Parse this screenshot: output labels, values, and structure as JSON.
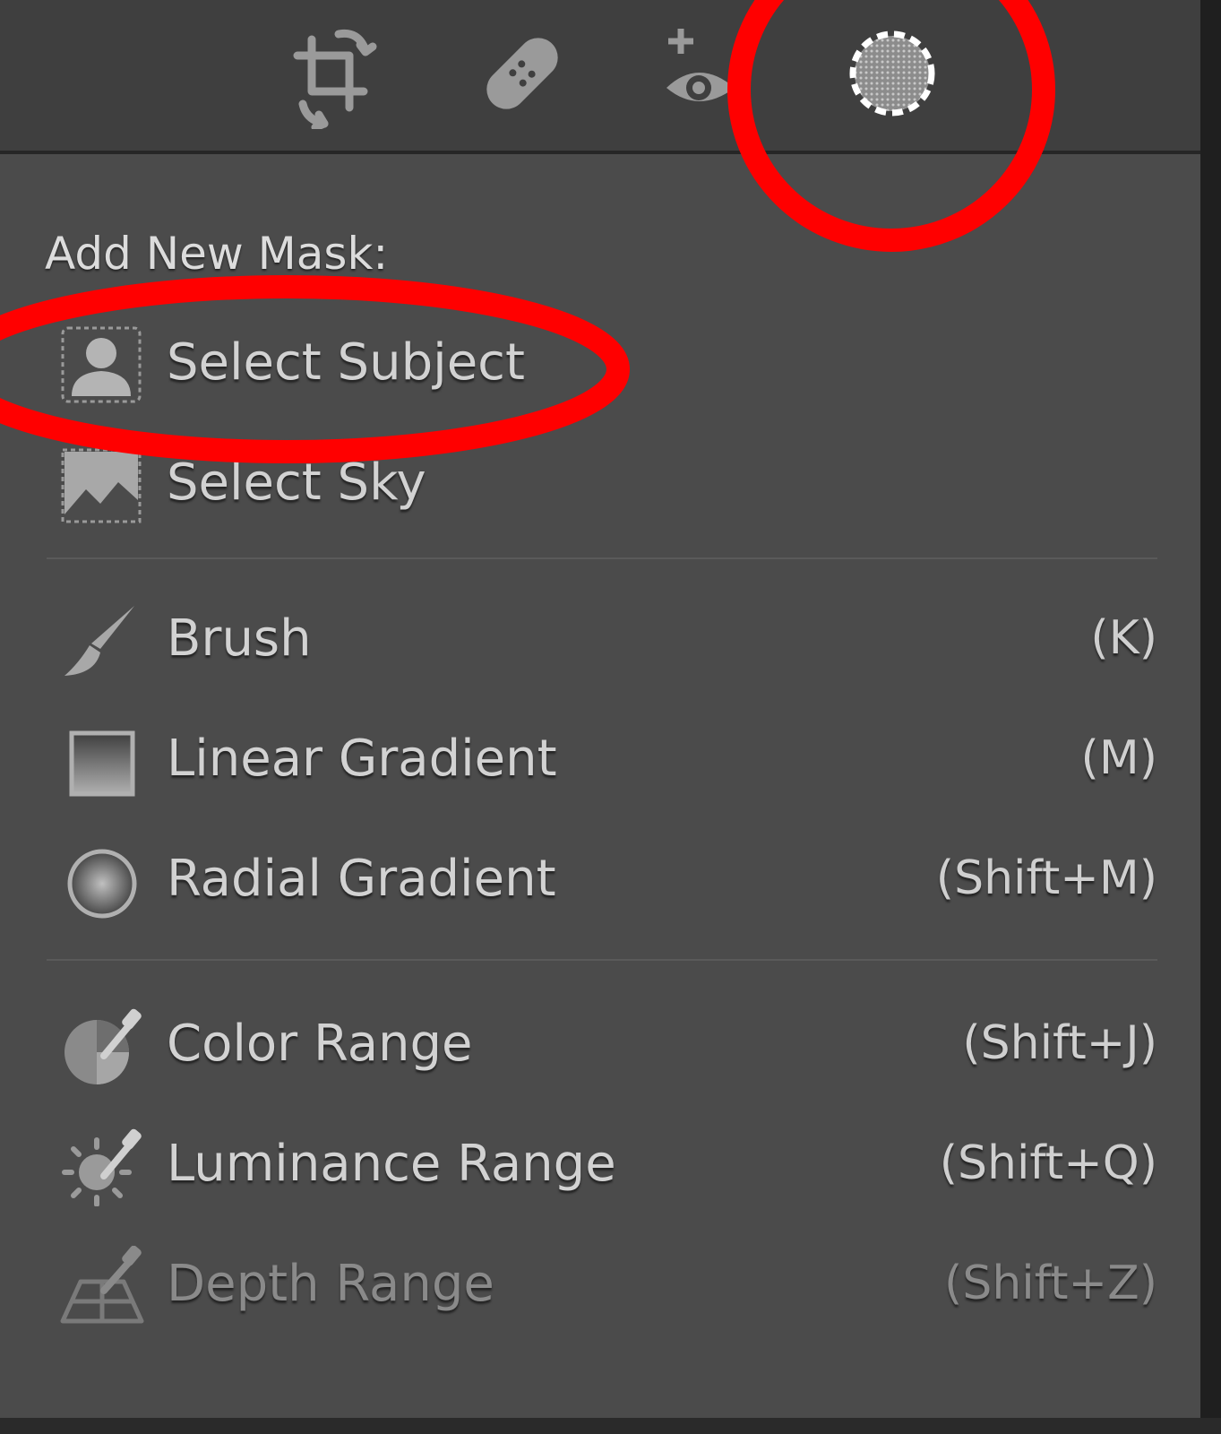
{
  "toolbar": {
    "tools": [
      {
        "name": "crop-icon"
      },
      {
        "name": "healing-bandage-icon"
      },
      {
        "name": "red-eye-icon"
      },
      {
        "name": "masking-icon"
      }
    ]
  },
  "panel": {
    "heading": "Add New Mask:",
    "items": [
      {
        "label": "Select Subject",
        "shortcut": "",
        "icon": "select-subject-icon"
      },
      {
        "label": "Select Sky",
        "shortcut": "",
        "icon": "select-sky-icon"
      },
      {
        "label": "Brush",
        "shortcut": "(K)",
        "icon": "brush-icon"
      },
      {
        "label": "Linear Gradient",
        "shortcut": "(M)",
        "icon": "linear-gradient-icon"
      },
      {
        "label": "Radial Gradient",
        "shortcut": "(Shift+M)",
        "icon": "radial-gradient-icon"
      },
      {
        "label": "Color Range",
        "shortcut": "(Shift+J)",
        "icon": "color-range-icon"
      },
      {
        "label": "Luminance Range",
        "shortcut": "(Shift+Q)",
        "icon": "luminance-range-icon"
      },
      {
        "label": "Depth Range",
        "shortcut": "(Shift+Z)",
        "icon": "depth-range-icon",
        "disabled": true
      }
    ]
  },
  "colors": {
    "panel_bg": "#4b4b4b",
    "toolbar_bg": "#3f3f3f",
    "text": "#d2d2d2",
    "annotation_red": "#ff0000"
  }
}
